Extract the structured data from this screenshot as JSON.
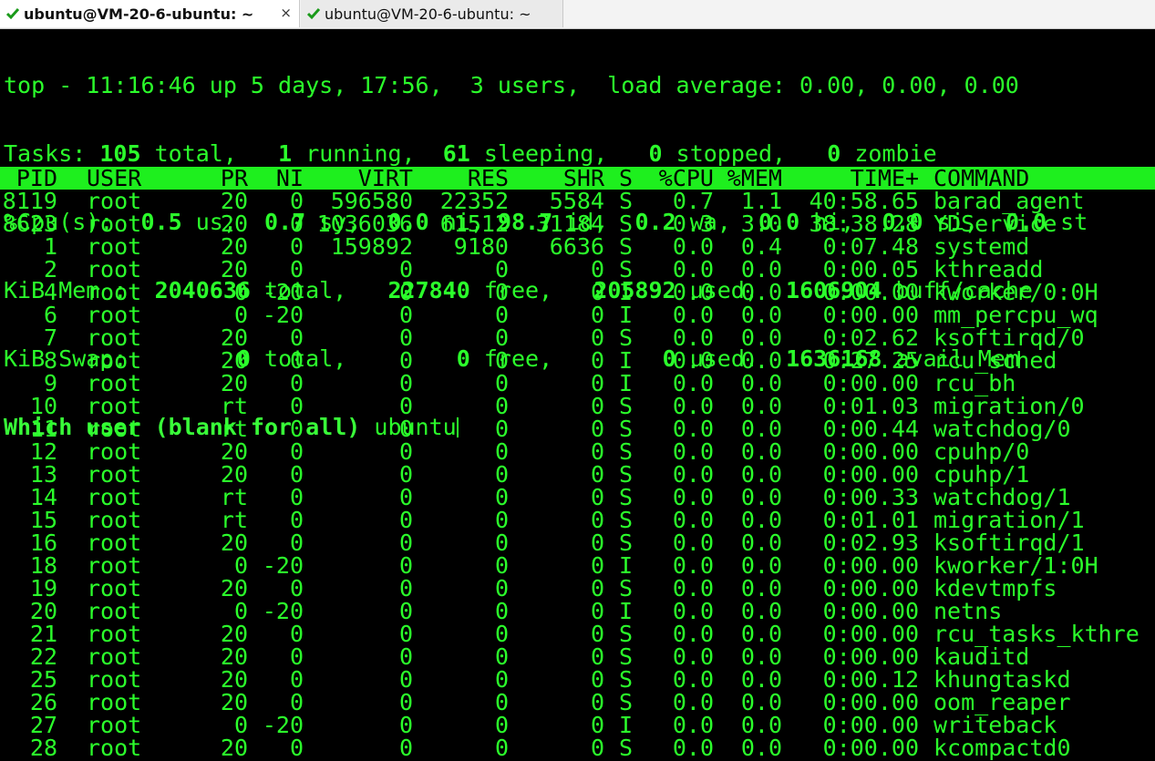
{
  "tabs": [
    {
      "title": "ubuntu@VM-20-6-ubuntu: ~",
      "close": "×",
      "active": true
    },
    {
      "title": "ubuntu@VM-20-6-ubuntu: ~",
      "active": false
    }
  ],
  "summary": {
    "line1": "top - 11:16:46 up 5 days, 17:56,  3 users,  load average: 0.00, 0.00, 0.00",
    "tasks": {
      "label": "Tasks:",
      "total": "105",
      "total_l": "total,",
      "running": "1",
      "running_l": "running,",
      "sleeping": "61",
      "sleeping_l": "sleeping,",
      "stopped": "0",
      "stopped_l": "stopped,",
      "zombie": "0",
      "zombie_l": "zombie"
    },
    "cpu": {
      "label": "%Cpu(s):",
      "us": "0.5",
      "us_l": "us,",
      "sy": "0.7",
      "sy_l": "sy,",
      "ni": "0.0",
      "ni_l": "ni,",
      "id": "98.7",
      "id_l": "id,",
      "wa": "0.2",
      "wa_l": "wa,",
      "hi": "0.0",
      "hi_l": "hi,",
      "si": "0.0",
      "si_l": "si,",
      "st": "0.0",
      "st_l": "st"
    },
    "mem": {
      "label": "KiB Mem :",
      "total": "2040636",
      "total_l": "total,",
      "free": "227840",
      "free_l": "free,",
      "used": "205892",
      "used_l": "used,",
      "cache": "1606904",
      "cache_l": "buff/cache"
    },
    "swap": {
      "label": "KiB Swap:",
      "total": "0",
      "total_l": "total,",
      "free": "0",
      "free_l": "free,",
      "used": "0",
      "used_l": "used.",
      "avail": "1636168",
      "avail_l": "avail Mem"
    }
  },
  "prompt": {
    "question": "Which user (blank for all)",
    "answer": "ubuntu"
  },
  "columns": [
    "PID",
    "USER",
    "PR",
    "NI",
    "VIRT",
    "RES",
    "SHR",
    "S",
    "%CPU",
    "%MEM",
    "TIME+",
    "COMMAND"
  ],
  "processes": [
    [
      "8119",
      "root",
      "20",
      "0",
      "596580",
      "22352",
      "5584",
      "S",
      "0.7",
      "1.1",
      "40:58.65",
      "barad_agent"
    ],
    [
      "8623",
      "root",
      "20",
      "0",
      "1036036",
      "61512",
      "31184",
      "S",
      "0.3",
      "3.0",
      "38:38.28",
      "YDService"
    ],
    [
      "1",
      "root",
      "20",
      "0",
      "159892",
      "9180",
      "6636",
      "S",
      "0.0",
      "0.4",
      "0:07.48",
      "systemd"
    ],
    [
      "2",
      "root",
      "20",
      "0",
      "0",
      "0",
      "0",
      "S",
      "0.0",
      "0.0",
      "0:00.05",
      "kthreadd"
    ],
    [
      "4",
      "root",
      "0",
      "-20",
      "0",
      "0",
      "0",
      "I",
      "0.0",
      "0.0",
      "0:00.00",
      "kworker/0:0H"
    ],
    [
      "6",
      "root",
      "0",
      "-20",
      "0",
      "0",
      "0",
      "I",
      "0.0",
      "0.0",
      "0:00.00",
      "mm_percpu_wq"
    ],
    [
      "7",
      "root",
      "20",
      "0",
      "0",
      "0",
      "0",
      "S",
      "0.0",
      "0.0",
      "0:02.62",
      "ksoftirqd/0"
    ],
    [
      "8",
      "root",
      "20",
      "0",
      "0",
      "0",
      "0",
      "I",
      "0.0",
      "0.0",
      "0:27.25",
      "rcu_sched"
    ],
    [
      "9",
      "root",
      "20",
      "0",
      "0",
      "0",
      "0",
      "I",
      "0.0",
      "0.0",
      "0:00.00",
      "rcu_bh"
    ],
    [
      "10",
      "root",
      "rt",
      "0",
      "0",
      "0",
      "0",
      "S",
      "0.0",
      "0.0",
      "0:01.03",
      "migration/0"
    ],
    [
      "11",
      "root",
      "rt",
      "0",
      "0",
      "0",
      "0",
      "S",
      "0.0",
      "0.0",
      "0:00.44",
      "watchdog/0"
    ],
    [
      "12",
      "root",
      "20",
      "0",
      "0",
      "0",
      "0",
      "S",
      "0.0",
      "0.0",
      "0:00.00",
      "cpuhp/0"
    ],
    [
      "13",
      "root",
      "20",
      "0",
      "0",
      "0",
      "0",
      "S",
      "0.0",
      "0.0",
      "0:00.00",
      "cpuhp/1"
    ],
    [
      "14",
      "root",
      "rt",
      "0",
      "0",
      "0",
      "0",
      "S",
      "0.0",
      "0.0",
      "0:00.33",
      "watchdog/1"
    ],
    [
      "15",
      "root",
      "rt",
      "0",
      "0",
      "0",
      "0",
      "S",
      "0.0",
      "0.0",
      "0:01.01",
      "migration/1"
    ],
    [
      "16",
      "root",
      "20",
      "0",
      "0",
      "0",
      "0",
      "S",
      "0.0",
      "0.0",
      "0:02.93",
      "ksoftirqd/1"
    ],
    [
      "18",
      "root",
      "0",
      "-20",
      "0",
      "0",
      "0",
      "I",
      "0.0",
      "0.0",
      "0:00.00",
      "kworker/1:0H"
    ],
    [
      "19",
      "root",
      "20",
      "0",
      "0",
      "0",
      "0",
      "S",
      "0.0",
      "0.0",
      "0:00.00",
      "kdevtmpfs"
    ],
    [
      "20",
      "root",
      "0",
      "-20",
      "0",
      "0",
      "0",
      "I",
      "0.0",
      "0.0",
      "0:00.00",
      "netns"
    ],
    [
      "21",
      "root",
      "20",
      "0",
      "0",
      "0",
      "0",
      "S",
      "0.0",
      "0.0",
      "0:00.00",
      "rcu_tasks_kthre"
    ],
    [
      "22",
      "root",
      "20",
      "0",
      "0",
      "0",
      "0",
      "S",
      "0.0",
      "0.0",
      "0:00.00",
      "kauditd"
    ],
    [
      "25",
      "root",
      "20",
      "0",
      "0",
      "0",
      "0",
      "S",
      "0.0",
      "0.0",
      "0:00.12",
      "khungtaskd"
    ],
    [
      "26",
      "root",
      "20",
      "0",
      "0",
      "0",
      "0",
      "S",
      "0.0",
      "0.0",
      "0:00.00",
      "oom_reaper"
    ],
    [
      "27",
      "root",
      "0",
      "-20",
      "0",
      "0",
      "0",
      "I",
      "0.0",
      "0.0",
      "0:00.00",
      "writeback"
    ],
    [
      "28",
      "root",
      "20",
      "0",
      "0",
      "0",
      "0",
      "S",
      "0.0",
      "0.0",
      "0:00.00",
      "kcompactd0"
    ]
  ],
  "colors": {
    "fg": "#2bff2b",
    "bg": "#000000",
    "header_bg": "#1eef1e",
    "tab_check": "#1a9a1a"
  },
  "icons": {
    "tab_status": "check-icon"
  }
}
